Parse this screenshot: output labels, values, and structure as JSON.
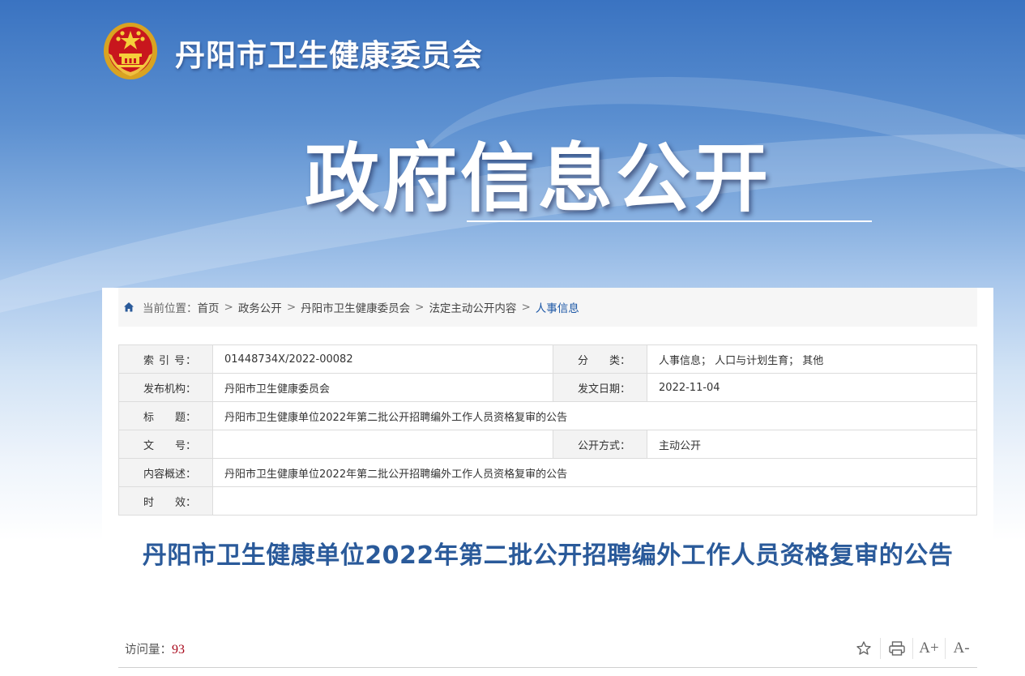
{
  "header": {
    "site_title": "丹阳市卫生健康委员会",
    "section_title": "政府信息公开"
  },
  "breadcrumb": {
    "prefix": "当前位置：",
    "items": [
      "首页",
      "政务公开",
      "丹阳市卫生健康委员会",
      "法定主动公开内容",
      "人事信息"
    ],
    "separator": ">"
  },
  "meta": {
    "index_label": "索 引 号：",
    "index_value": "01448734X/2022-00082",
    "category_label": "分　　类：",
    "category_value": "人事信息；  人口与计划生育；  其他",
    "publisher_label": "发布机构：",
    "publisher_value": "丹阳市卫生健康委员会",
    "date_label": "发文日期：",
    "date_value": "2022-11-04",
    "title_label": "标　　题：",
    "title_value": "丹阳市卫生健康单位2022年第二批公开招聘编外工作人员资格复审的公告",
    "docno_label": "文　　号：",
    "docno_value": "",
    "method_label": "公开方式：",
    "method_value": "主动公开",
    "summary_label": "内容概述：",
    "summary_value": "丹阳市卫生健康单位2022年第二批公开招聘编外工作人员资格复审的公告",
    "validity_label": "时　　效：",
    "validity_value": ""
  },
  "article": {
    "title": "丹阳市卫生健康单位2022年第二批公开招聘编外工作人员资格复审的公告",
    "visits_label": "访问量：",
    "visits_count": "93"
  },
  "toolbar": {
    "font_increase": "A+",
    "font_decrease": "A-"
  },
  "colors": {
    "accent": "#1d58a6",
    "title": "#2a5a9a",
    "visits": "#a8071a"
  },
  "icons": [
    "national-emblem-icon",
    "home-icon",
    "star-icon",
    "print-icon",
    "font-increase-icon",
    "font-decrease-icon"
  ]
}
